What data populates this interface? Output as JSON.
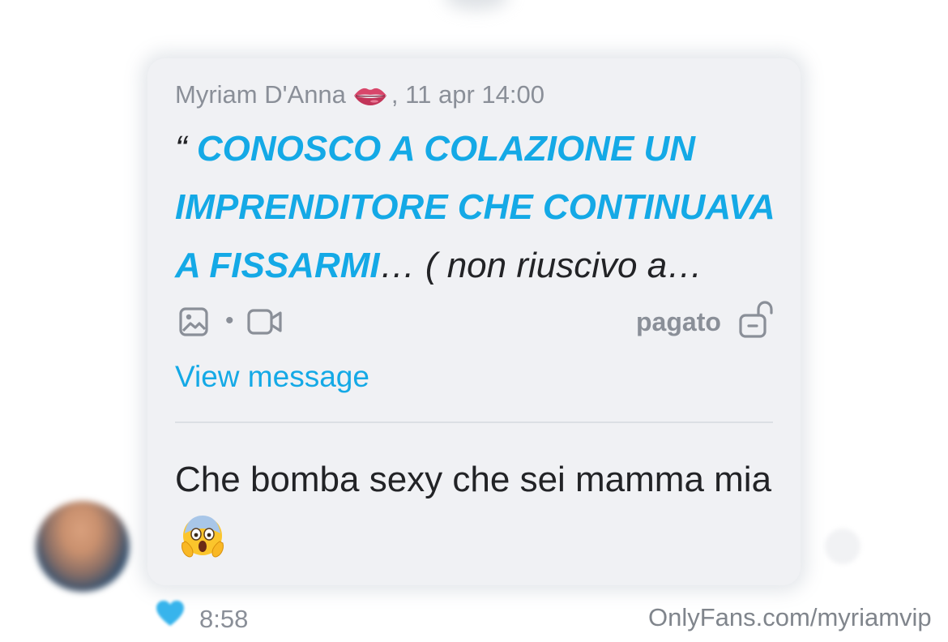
{
  "message": {
    "sender_name": "Myriam D'Anna",
    "sender_emoji_icon": "lips-icon",
    "date_separator": ",",
    "timestamp": "11 apr 14:00",
    "quote_mark": "“",
    "quote_highlight": "CONOSCO A COLAZIONE UN IMPRENDITORE CHE CONTINUAVA A FISSARMI",
    "quote_rest": "… ( non riuscivo a…",
    "media_icons": [
      "image-icon",
      "video-icon"
    ],
    "media_separator": "•",
    "status_label": "pagato",
    "status_icon": "unlocked-icon",
    "view_link": "View message"
  },
  "reply": {
    "text": "Che bomba sexy che sei mamma mia",
    "emoji_icon": "face-screaming-in-fear-icon"
  },
  "footer": {
    "like_icon": "heart-icon",
    "time": "8:58",
    "watermark": "OnlyFans.com/myriamvip"
  },
  "colors": {
    "accent": "#14a9e6",
    "muted_text": "#8a8f98",
    "body_text": "#222326",
    "bubble_bg": "#f0f1f4"
  }
}
